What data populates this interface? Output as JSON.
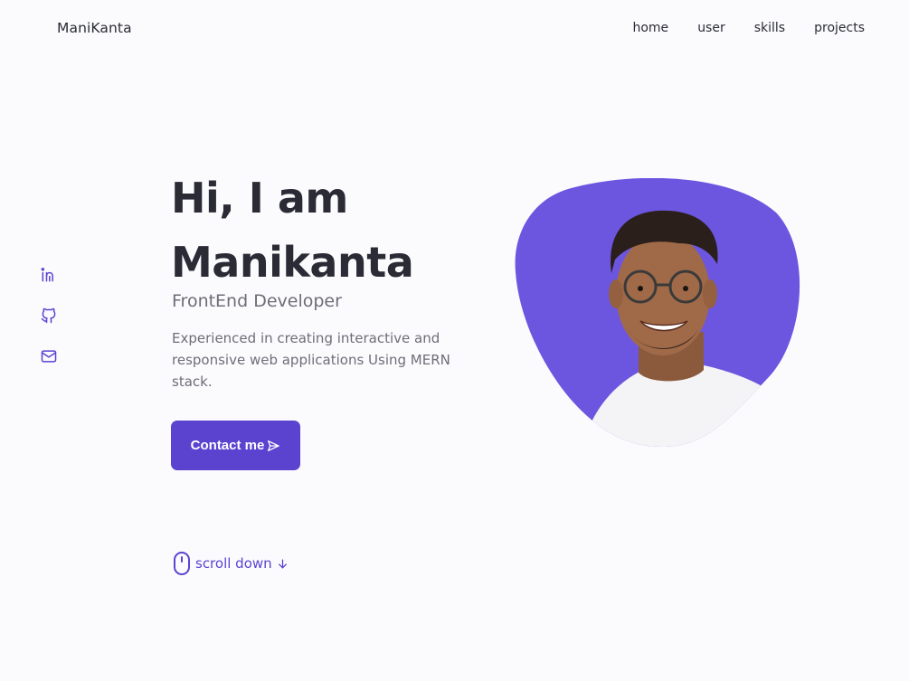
{
  "header": {
    "logo": "ManiKanta",
    "nav": [
      {
        "label": "home"
      },
      {
        "label": "user"
      },
      {
        "label": "skills"
      },
      {
        "label": "projects"
      }
    ]
  },
  "socials": [
    {
      "icon": "linkedin-icon"
    },
    {
      "icon": "github-icon"
    },
    {
      "icon": "mail-icon"
    }
  ],
  "hero": {
    "title_line1": "Hi, I am",
    "title_line2": "Manikanta",
    "subtitle": "FrontEnd Developer",
    "description": "Experienced in creating interactive and responsive web applications Using MERN stack.",
    "contact_label": "Contact me",
    "scroll_label": "scroll down"
  },
  "colors": {
    "accent": "#5b43d0",
    "blob": "#6c56e0",
    "text": "#2b2b36",
    "muted": "#6e6d78",
    "background": "#fbfbfe"
  }
}
